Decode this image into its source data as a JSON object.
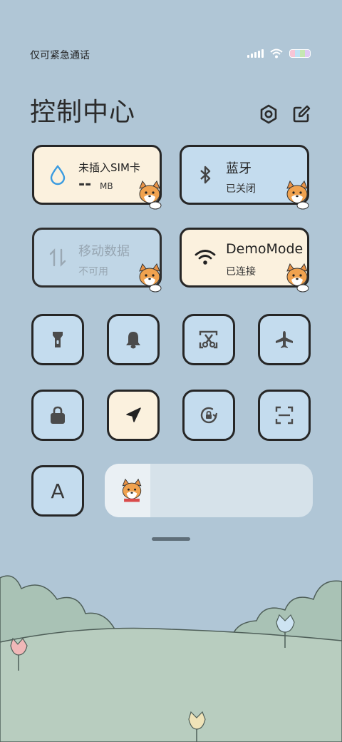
{
  "status_bar": {
    "carrier_text": "仅可紧急通话",
    "icons": [
      "signal-icon",
      "wifi-icon",
      "battery-icon"
    ],
    "battery_colors": [
      "#f7c5d6",
      "#bfe3f5",
      "#c6e7b3",
      "#e0c9f4"
    ]
  },
  "header": {
    "title": "控制中心",
    "icons": [
      "settings-hexagon-icon",
      "edit-icon"
    ]
  },
  "tiles": {
    "sim": {
      "title": "未插入SIM卡",
      "value": "--",
      "unit": "MB",
      "icon": "water-drop-icon",
      "color": "#fbf1de"
    },
    "bluetooth": {
      "title": "蓝牙",
      "status": "已关闭",
      "icon": "bluetooth-icon",
      "color": "#c4dcee"
    },
    "mobile_data": {
      "title": "移动数据",
      "status": "不可用",
      "icon": "data-arrows-icon",
      "color": "#c0d6e6"
    },
    "wifi": {
      "title": "DemoMode",
      "status": "已连接",
      "icon": "wifi-icon",
      "color": "#fbf1de"
    }
  },
  "toggles": [
    {
      "name": "flashlight",
      "icon": "flashlight-icon",
      "active": false
    },
    {
      "name": "sound",
      "icon": "bell-icon",
      "active": false
    },
    {
      "name": "screenshot",
      "icon": "scissors-icon",
      "active": false
    },
    {
      "name": "airplane",
      "icon": "airplane-icon",
      "active": false
    },
    {
      "name": "lock",
      "icon": "lock-icon",
      "active": false
    },
    {
      "name": "location",
      "icon": "location-arrow-icon",
      "active": true
    },
    {
      "name": "auto-rotate",
      "icon": "rotate-lock-icon",
      "active": false
    },
    {
      "name": "scan",
      "icon": "scan-icon",
      "active": false
    },
    {
      "name": "font",
      "label": "A",
      "icon": "font-icon",
      "active": false
    }
  ],
  "brightness": {
    "level": 0.22,
    "icon": "corgi-icon"
  },
  "colors": {
    "background": "#b0c6d6",
    "cream": "#fbf1de",
    "blue": "#c4dcee",
    "border": "#262626"
  }
}
